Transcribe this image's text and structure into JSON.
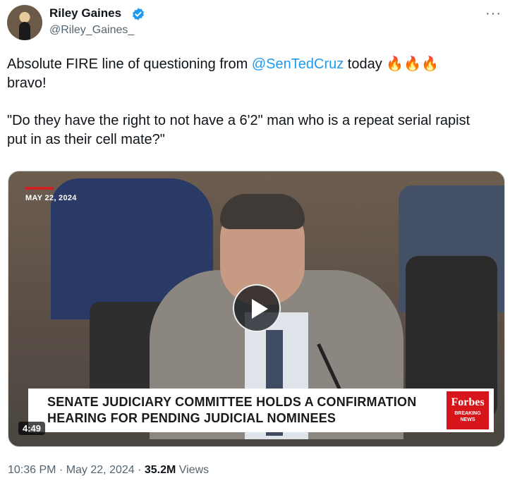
{
  "author": {
    "display_name": "Riley Gaines",
    "handle": "@Riley_Gaines_",
    "verified": true
  },
  "more_label": "···",
  "tweet": {
    "line1_before": "Absolute FIRE line of questioning from ",
    "mention": "@SenTedCruz",
    "line1_after": " today ",
    "emoji": "🔥🔥🔥",
    "line2": "bravo!",
    "quote": "\"Do they have the right to not have a 6'2\" man who is a repeat serial rapist put in as their cell mate?\""
  },
  "video": {
    "date_stamp": "MAY 22, 2024",
    "lower_third": "SENATE JUDICIARY COMMITTEE HOLDS A CONFIRMATION HEARING FOR PENDING JUDICIAL NOMINEES",
    "brand": "Forbes",
    "brand_sub": "BREAKING NEWS",
    "duration": "4:49"
  },
  "meta": {
    "time": "10:36 PM",
    "separator1": " · ",
    "date": "May 22, 2024",
    "separator2": " · ",
    "views": "35.2M",
    "views_label": " Views"
  },
  "colors": {
    "accent": "#1d9bf0",
    "text": "#0f1419",
    "muted": "#536471",
    "forbes_red": "#d8141b"
  }
}
